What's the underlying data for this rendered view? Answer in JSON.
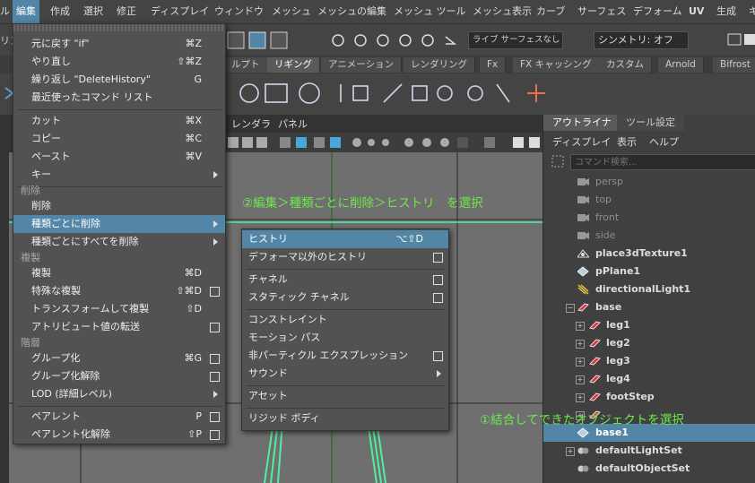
{
  "menubar": {
    "items": [
      "ル",
      "編集",
      "作成",
      "選択",
      "修正",
      "ディスプレイ",
      "ウィンドウ",
      "メッシュ",
      "メッシュの編集",
      "メッシュ ツール",
      "メッシュ表示",
      "カーブ",
      "サーフェス",
      "デフォーム",
      "UV",
      "生成",
      "キ"
    ]
  },
  "shelf1": {
    "live_surface": "ライブ サーフェスなし",
    "symmetry": "シンメトリ: オフ",
    "left_fragment": "リン"
  },
  "shelf_tabs": [
    "ルプト",
    "リギング",
    "アニメーション",
    "レンダリング",
    "Fx",
    "FX キャッシング",
    "カスタム",
    "Arnold",
    "Bifrost"
  ],
  "viewport_menu": [
    "レンダラ",
    "パネル"
  ],
  "outliner": {
    "tabs": [
      "アウトライナ",
      "ツール設定"
    ],
    "menu": [
      "ディスプレイ",
      "表示",
      "ヘルプ"
    ],
    "search_placeholder": "コマンド検索...",
    "rows": [
      {
        "label": "persp",
        "icon": "camera-icon"
      },
      {
        "label": "top",
        "icon": "camera-icon"
      },
      {
        "label": "front",
        "icon": "camera-icon"
      },
      {
        "label": "side",
        "icon": "camera-icon"
      },
      {
        "label": "place3dTexture1",
        "icon": "texture-icon"
      },
      {
        "label": "pPlane1",
        "icon": "mesh-icon"
      },
      {
        "label": "directionalLight1",
        "icon": "light-icon"
      },
      {
        "label": "base",
        "icon": "mesh-red-icon"
      },
      {
        "label": "leg1",
        "icon": "mesh-red-icon"
      },
      {
        "label": "leg2",
        "icon": "mesh-red-icon"
      },
      {
        "label": "leg3",
        "icon": "mesh-red-icon"
      },
      {
        "label": "leg4",
        "icon": "mesh-red-icon"
      },
      {
        "label": "footStep",
        "icon": "mesh-red-icon"
      },
      {
        "label": "",
        "icon": "mesh-red-icon"
      },
      {
        "label": "base1",
        "icon": "mesh-icon"
      },
      {
        "label": "defaultLightSet",
        "icon": "set-icon"
      },
      {
        "label": "defaultObjectSet",
        "icon": "set-icon"
      }
    ]
  },
  "edit_menu": {
    "items": [
      {
        "label": "元に戻す \"if\"",
        "key": "⌘Z"
      },
      {
        "label": "やり直し",
        "key": "⇧⌘Z"
      },
      {
        "label": "繰り返し \"DeleteHistory\"",
        "key": "G"
      },
      {
        "label": "最近使ったコマンド リスト",
        "key": ""
      },
      {
        "label": "カット",
        "key": "⌘X"
      },
      {
        "label": "コピー",
        "key": "⌘C"
      },
      {
        "label": "ペースト",
        "key": "⌘V"
      },
      {
        "label": "キー",
        "key": ""
      },
      {
        "label": "削除",
        "key": ""
      },
      {
        "label": "削除",
        "key": ""
      },
      {
        "label": "種類ごとに削除",
        "key": ""
      },
      {
        "label": "種類ごとにすべてを削除",
        "key": ""
      },
      {
        "label": "複製",
        "key": ""
      },
      {
        "label": "複製",
        "key": "⌘D"
      },
      {
        "label": "特殊な複製",
        "key": "⇧⌘D"
      },
      {
        "label": "トランスフォームして複製",
        "key": "⇧D"
      },
      {
        "label": "アトリビュート値の転送",
        "key": ""
      },
      {
        "label": "階層",
        "key": ""
      },
      {
        "label": "グループ化",
        "key": "⌘G"
      },
      {
        "label": "グループ化解除",
        "key": ""
      },
      {
        "label": "LOD (詳細レベル)",
        "key": ""
      },
      {
        "label": "ペアレント",
        "key": "P"
      },
      {
        "label": "ペアレント化解除",
        "key": "⇧P"
      }
    ]
  },
  "delete_by_type_menu": {
    "items": [
      {
        "label": "ヒストリ",
        "key": "⌥⇧D"
      },
      {
        "label": "デフォーマ以外のヒストリ",
        "key": ""
      },
      {
        "label": "チャネル",
        "key": ""
      },
      {
        "label": "スタティック チャネル",
        "key": ""
      },
      {
        "label": "コンストレイント",
        "key": ""
      },
      {
        "label": "モーション パス",
        "key": ""
      },
      {
        "label": "非パーティクル エクスプレッション",
        "key": ""
      },
      {
        "label": "サウンド",
        "key": ""
      },
      {
        "label": "アセット",
        "key": ""
      },
      {
        "label": "リジッド ボディ",
        "key": ""
      }
    ]
  },
  "annotations": {
    "step2": "②編集＞種類ごとに削除＞ヒストリ　を選択",
    "step1": "①結合してできたオブジェクトを選択"
  },
  "colors": {
    "highlight": "#5285a6",
    "annotation": "#6ee84c",
    "wireframe": "#4ef0a0"
  }
}
